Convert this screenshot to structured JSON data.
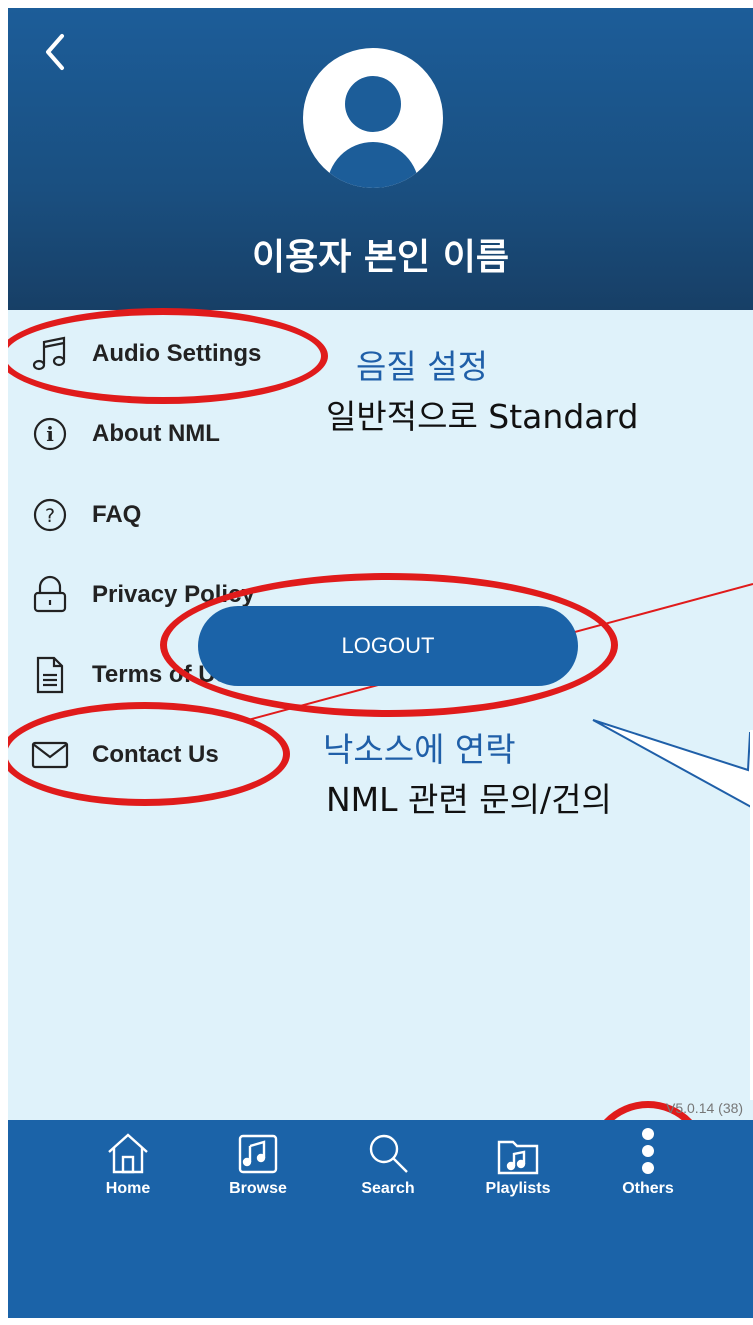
{
  "header": {
    "back_icon": "chevron-left-icon",
    "avatar_icon": "user-avatar-icon",
    "username": "이용자 본인 이름"
  },
  "menu": {
    "items": [
      {
        "label": "Audio Settings",
        "icon": "music-note-icon"
      },
      {
        "label": "About NML",
        "icon": "info-icon"
      },
      {
        "label": "FAQ",
        "icon": "question-icon"
      },
      {
        "label": "Privacy Policy",
        "icon": "lock-icon"
      },
      {
        "label": "Terms of Use",
        "icon": "document-icon"
      },
      {
        "label": "Contact Us",
        "icon": "mail-icon"
      }
    ]
  },
  "annotations": {
    "audio_title": "음질 설정",
    "audio_desc": "일반적으로 Standard",
    "contact_title": "낙소스에 연락",
    "contact_desc": "NML 관련 문의/건의"
  },
  "logout_label": "LOGOUT",
  "version": "V5.0.14 (38)",
  "tabbar": {
    "tabs": [
      {
        "label": "Home",
        "icon": "home-icon"
      },
      {
        "label": "Browse",
        "icon": "book-icon"
      },
      {
        "label": "Search",
        "icon": "search-icon"
      },
      {
        "label": "Playlists",
        "icon": "folder-music-icon"
      },
      {
        "label": "Others",
        "icon": "more-vertical-icon"
      }
    ]
  },
  "colors": {
    "header_bg": "#1c5d99",
    "content_bg": "#dff2fa",
    "tabbar_bg": "#1b63a8",
    "annotation_red": "#e01b1b",
    "annotation_blue": "#1f5fa8"
  }
}
